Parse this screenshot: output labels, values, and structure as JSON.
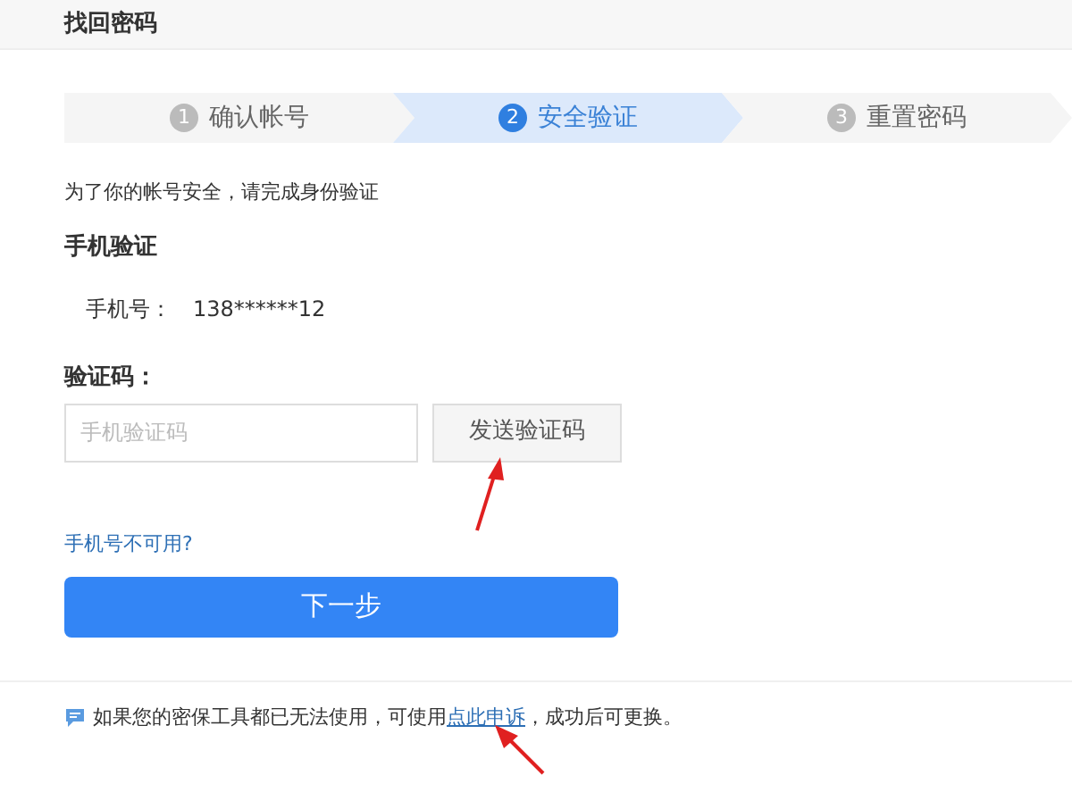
{
  "header": {
    "title": "找回密码"
  },
  "steps": [
    {
      "number": "1",
      "label": "确认帐号",
      "selected": false
    },
    {
      "number": "2",
      "label": "安全验证",
      "selected": true
    },
    {
      "number": "3",
      "label": "重置密码",
      "selected": false
    }
  ],
  "intro": "为了你的帐号安全，请完成身份验证",
  "section_title": "手机验证",
  "phone": {
    "label": "手机号：",
    "value": "138******12"
  },
  "code": {
    "label": "验证码：",
    "placeholder": "手机验证码",
    "send_button": "发送验证码"
  },
  "phone_unavailable_link": "手机号不可用?",
  "next_button": "下一步",
  "notice": {
    "before": "如果您的密保工具都已无法使用，可使用",
    "link": "点此申诉",
    "after": "，成功后可更换。"
  }
}
